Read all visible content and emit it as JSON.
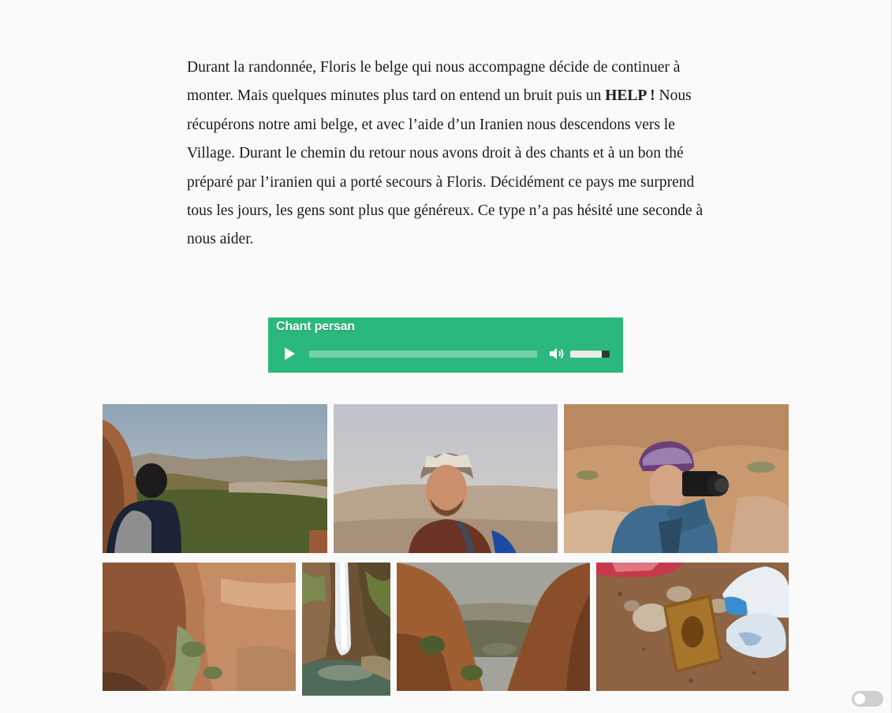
{
  "story": {
    "part1": "Durant la randonnée, Floris le belge qui nous accompagne décide de continuer à monter. Mais quelques minutes plus tard on entend un bruit puis un ",
    "help": "HELP !",
    "part2": " Nous récupérons notre ami belge, et avec l’aide d’un Iranien nous descendons vers le Village. Durant le chemin du retour nous avons droit à des chants et à un bon thé préparé par l’iranien qui a porté secours à Floris. Décidément ce pays me surprend tous les jours, les gens sont plus que généreux. Ce type n’a pas hésité une seconde à nous aider."
  },
  "audio": {
    "title": "Chant persan",
    "progress": 0,
    "volume": 0.8,
    "background_color": "#2bb87d",
    "play_icon": "play-icon",
    "volume_icon": "speaker-icon"
  },
  "gallery": {
    "photos": [
      {
        "subject": "hiker-overlooking-valley"
      },
      {
        "subject": "man-with-keffiyeh-portrait"
      },
      {
        "subject": "photographer-with-camera"
      },
      {
        "subject": "rocky-canyon"
      },
      {
        "subject": "waterfall"
      },
      {
        "subject": "gorge-with-village"
      },
      {
        "subject": "book-on-ground"
      }
    ]
  },
  "theme_toggle": {
    "state": "off"
  }
}
